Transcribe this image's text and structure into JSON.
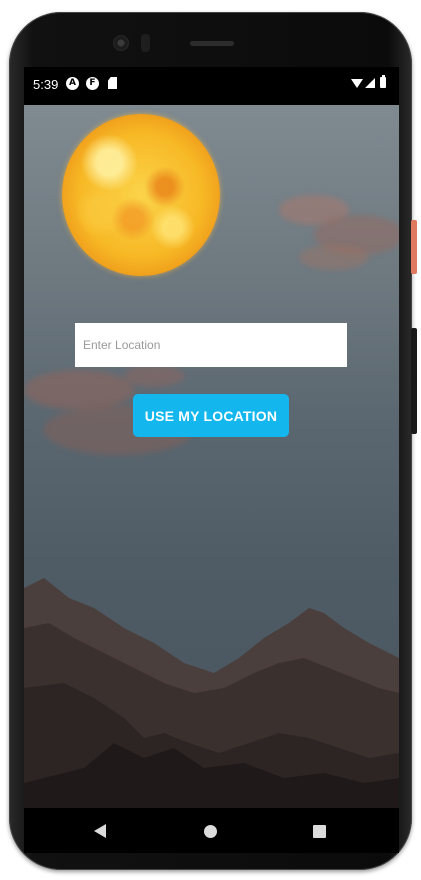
{
  "status_bar": {
    "time": "5:39",
    "icons": [
      "a-notification-icon",
      "f-notification-icon",
      "sd-card-icon",
      "wifi-icon",
      "signal-icon",
      "battery-icon"
    ],
    "icon_letters": {
      "a": "A",
      "f": "F"
    }
  },
  "main": {
    "location_input": {
      "placeholder": "Enter Location",
      "value": ""
    },
    "use_location_button": "USE MY LOCATION"
  },
  "nav_bar": {
    "icons": [
      "back-icon",
      "home-icon",
      "recents-icon"
    ]
  },
  "colors": {
    "accent": "#14b6ee",
    "sky_top": "#7f8a91",
    "sky_bottom": "#48545e",
    "sun": "#f7b825"
  }
}
